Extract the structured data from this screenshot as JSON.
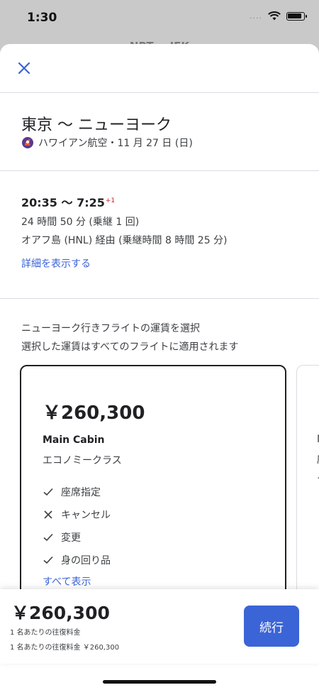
{
  "status_bar": {
    "time": "1:30",
    "signal": "....",
    "wifi_icon": "wifi-icon",
    "battery_icon": "battery-icon"
  },
  "behind_title": "NRT → JFK",
  "header": {
    "close_icon": "close-icon"
  },
  "trip": {
    "title": "東京 ～ ニューヨーク",
    "airline": "ハワイアン航空・11 月 27 日 (日)"
  },
  "flight": {
    "times": "20:35 ～ 7:25",
    "day_offset": "+1",
    "duration": "24 時間 50 分 (乗継 1 回)",
    "via": "オアフ島 (HNL) 経由 (乗継時間 8 時間 25 分)",
    "details_link": "詳細を表示する"
  },
  "fare_select": {
    "heading1": "ニューヨーク行きフライトの運賃を選択",
    "heading2": "選択した運賃はすべてのフライトに適用されます"
  },
  "fare_card": {
    "price": "￥260,300",
    "cabin": "Main Cabin",
    "cabin_jp": "エコノミークラス",
    "features": [
      {
        "icon": "check-icon",
        "label": "座席指定"
      },
      {
        "icon": "x-icon",
        "label": "キャンセル"
      },
      {
        "icon": "check-icon",
        "label": "変更"
      },
      {
        "icon": "check-icon",
        "label": "身の回り品"
      }
    ],
    "show_all": "すべて表示"
  },
  "second_card": {
    "stub1": "M",
    "stub2": "座",
    "stub3": "イ"
  },
  "footer": {
    "price": "￥260,300",
    "per_person": "1 名あたりの往復料金",
    "per_person_total": "1 名あたりの往復料金 ￥260,300",
    "continue_label": "続行"
  },
  "colors": {
    "accent": "#3b64d6",
    "text": "#202124"
  }
}
